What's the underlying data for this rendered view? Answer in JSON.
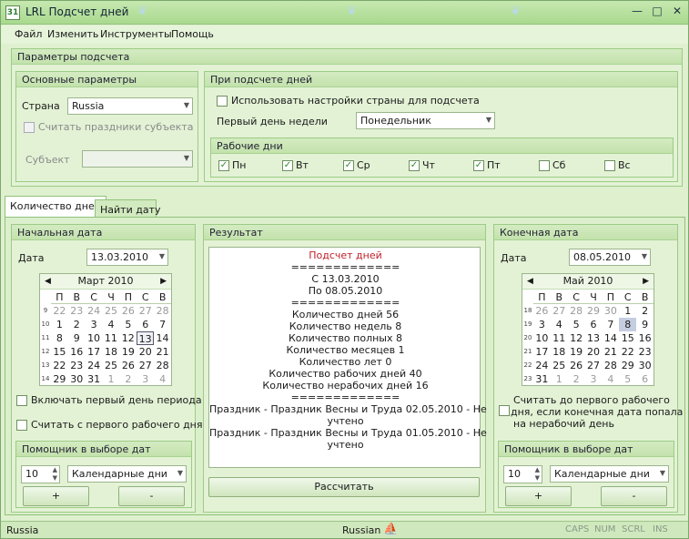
{
  "window": {
    "title": "LRL Подсчет дней",
    "icon_text": "31"
  },
  "menu": {
    "items": [
      "Файл",
      "Изменить",
      "Инструменты",
      "Помощь"
    ]
  },
  "params": {
    "header": "Параметры подсчета",
    "main": {
      "header": "Основные параметры",
      "country_label": "Страна",
      "country_value": "Russia",
      "subject_holidays_label": "Считать праздники субъекта",
      "subject_label": "Субъект",
      "subject_value": ""
    },
    "counting": {
      "header": "При подсчете дней",
      "use_country_label": "Использовать настройки страны для подсчета",
      "use_country_checked": false,
      "first_day_label": "Первый день недели",
      "first_day_value": "Понедельник"
    },
    "workdays": {
      "header": "Рабочие дни",
      "days": [
        {
          "label": "Пн",
          "checked": true
        },
        {
          "label": "Вт",
          "checked": true
        },
        {
          "label": "Ср",
          "checked": true
        },
        {
          "label": "Чт",
          "checked": true
        },
        {
          "label": "Пт",
          "checked": true
        },
        {
          "label": "Сб",
          "checked": false
        },
        {
          "label": "Вс",
          "checked": false
        }
      ]
    }
  },
  "tabs": {
    "count_days": "Количество дней",
    "find_date": "Найти дату",
    "active": "count_days"
  },
  "start": {
    "header": "Начальная дата",
    "date_label": "Дата",
    "date_value": "13.03.2010",
    "month_title": "Март 2010",
    "weekdays": [
      "П",
      "В",
      "С",
      "Ч",
      "П",
      "С",
      "В"
    ],
    "weeks": [
      {
        "wk": "9",
        "days": [
          "22",
          "23",
          "24",
          "25",
          "26",
          "27",
          "28"
        ],
        "other": [
          true,
          true,
          true,
          true,
          true,
          true,
          true
        ]
      },
      {
        "wk": "10",
        "days": [
          "1",
          "2",
          "3",
          "4",
          "5",
          "6",
          "7"
        ],
        "other": [
          false,
          false,
          false,
          false,
          false,
          false,
          false
        ]
      },
      {
        "wk": "11",
        "days": [
          "8",
          "9",
          "10",
          "11",
          "12",
          "13",
          "14"
        ],
        "other": [
          false,
          false,
          false,
          false,
          false,
          false,
          false
        ]
      },
      {
        "wk": "12",
        "days": [
          "15",
          "16",
          "17",
          "18",
          "19",
          "20",
          "21"
        ],
        "other": [
          false,
          false,
          false,
          false,
          false,
          false,
          false
        ]
      },
      {
        "wk": "13",
        "days": [
          "22",
          "23",
          "24",
          "25",
          "26",
          "27",
          "28"
        ],
        "other": [
          false,
          false,
          false,
          false,
          false,
          false,
          false
        ]
      },
      {
        "wk": "14",
        "days": [
          "29",
          "30",
          "31",
          "1",
          "2",
          "3",
          "4"
        ],
        "other": [
          false,
          false,
          false,
          true,
          true,
          true,
          true
        ]
      }
    ],
    "selected_day": "13",
    "include_first_label": "Включать первый день периода",
    "from_first_work_label": "Считать с первого рабочего дня",
    "helper": {
      "header": "Помощник в выборе дат",
      "count": "10",
      "mode": "Календарные дни",
      "plus": "+",
      "minus": "-"
    }
  },
  "result": {
    "header": "Результат",
    "lines": [
      {
        "text": "Подсчет дней",
        "color": "#c0202a"
      },
      {
        "text": "=============",
        "color": "#1a1a1a"
      },
      {
        "text": "С 13.03.2010",
        "color": "#1a1a1a"
      },
      {
        "text": "По 08.05.2010",
        "color": "#1a1a1a"
      },
      {
        "text": "=============",
        "color": "#1a1a1a"
      },
      {
        "text": "Количество дней 56",
        "color": "#1a1a1a"
      },
      {
        "text": "Количество недель 8",
        "color": "#1a1a1a"
      },
      {
        "text": "Количество полных 8",
        "color": "#1a1a1a"
      },
      {
        "text": "Количество месяцев 1",
        "color": "#1a1a1a"
      },
      {
        "text": "Количество лет 0",
        "color": "#1a1a1a"
      },
      {
        "text": "Количество рабочих дней 40",
        "color": "#1a1a1a"
      },
      {
        "text": "Количество нерабочих дней 16",
        "color": "#1a1a1a"
      },
      {
        "text": "=============",
        "color": "#1a1a1a"
      },
      {
        "text": "Праздник - Праздник Весны и Труда 02.05.2010 - Не",
        "color": "#1a1a1a"
      },
      {
        "text": "учтено",
        "color": "#1a1a1a"
      },
      {
        "text": "Праздник - Праздник Весны и Труда 01.05.2010 - Не",
        "color": "#1a1a1a"
      },
      {
        "text": "учтено",
        "color": "#1a1a1a"
      }
    ],
    "calc_button": "Рассчитать"
  },
  "end": {
    "header": "Конечная дата",
    "date_label": "Дата",
    "date_value": "08.05.2010",
    "month_title": "Май 2010",
    "weekdays": [
      "П",
      "В",
      "С",
      "Ч",
      "П",
      "С",
      "В"
    ],
    "weeks": [
      {
        "wk": "18",
        "days": [
          "26",
          "27",
          "28",
          "29",
          "30",
          "1",
          "2"
        ],
        "other": [
          true,
          true,
          true,
          true,
          true,
          false,
          false
        ]
      },
      {
        "wk": "19",
        "days": [
          "3",
          "4",
          "5",
          "6",
          "7",
          "8",
          "9"
        ],
        "other": [
          false,
          false,
          false,
          false,
          false,
          false,
          false
        ]
      },
      {
        "wk": "20",
        "days": [
          "10",
          "11",
          "12",
          "13",
          "14",
          "15",
          "16"
        ],
        "other": [
          false,
          false,
          false,
          false,
          false,
          false,
          false
        ]
      },
      {
        "wk": "21",
        "days": [
          "17",
          "18",
          "19",
          "20",
          "21",
          "22",
          "23"
        ],
        "other": [
          false,
          false,
          false,
          false,
          false,
          false,
          false
        ]
      },
      {
        "wk": "22",
        "days": [
          "24",
          "25",
          "26",
          "27",
          "28",
          "29",
          "30"
        ],
        "other": [
          false,
          false,
          false,
          false,
          false,
          false,
          false
        ]
      },
      {
        "wk": "23",
        "days": [
          "31",
          "1",
          "2",
          "3",
          "4",
          "5",
          "6"
        ],
        "other": [
          false,
          true,
          true,
          true,
          true,
          true,
          true
        ]
      }
    ],
    "selected_day": "8",
    "first_work_note": "Считать до первого рабочего дня, если конечная дата попала на нерабочий день",
    "first_work_line1": "Считать до первого рабочего",
    "first_work_line2": "дня, если конечная дата попала",
    "first_work_line3": "на нерабочий день",
    "helper": {
      "header": "Помощник в выборе дат",
      "count": "10",
      "mode": "Календарные дни",
      "plus": "+",
      "minus": "-"
    }
  },
  "status": {
    "country": "Russia",
    "language": "Russian",
    "indicators": [
      "CAPS",
      "NUM",
      "SCRL",
      "INS"
    ]
  }
}
